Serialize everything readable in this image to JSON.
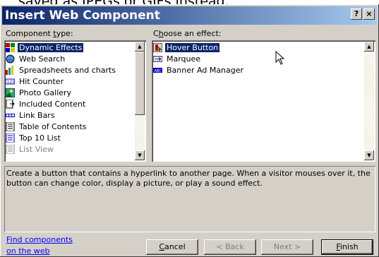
{
  "background_text": "saved as JPEGs or GIFs instead.",
  "window": {
    "title": "Insert Web Component",
    "help_button": "?",
    "close_button": "×"
  },
  "component_type": {
    "label_prefix": "Component ",
    "label_hot": "t",
    "label_suffix": "ype:",
    "items": [
      {
        "label": "Dynamic Effects",
        "icon": "effects-icon",
        "selected": true
      },
      {
        "label": "Web Search",
        "icon": "web-search-icon"
      },
      {
        "label": "Spreadsheets and charts",
        "icon": "spreadsheet-icon"
      },
      {
        "label": "Hit Counter",
        "icon": "hit-counter-icon"
      },
      {
        "label": "Photo Gallery",
        "icon": "photo-gallery-icon"
      },
      {
        "label": "Included Content",
        "icon": "included-content-icon"
      },
      {
        "label": "Link Bars",
        "icon": "link-bars-icon"
      },
      {
        "label": "Table of Contents",
        "icon": "table-of-contents-icon"
      },
      {
        "label": "Top 10 List",
        "icon": "top10-list-icon"
      },
      {
        "label": "List View",
        "icon": "list-view-icon",
        "disabled": true
      }
    ]
  },
  "effect": {
    "label_prefix": "C",
    "label_hot": "h",
    "label_suffix": "oose an effect:",
    "items": [
      {
        "label": "Hover Button",
        "icon": "hover-button-icon",
        "selected": true
      },
      {
        "label": "Marquee",
        "icon": "marquee-icon"
      },
      {
        "label": "Banner Ad Manager",
        "icon": "banner-ad-icon"
      }
    ]
  },
  "description": "Create a button that contains a hyperlink to another page.  When a visitor mouses over it, the button can change color, display a picture, or play a sound effect.",
  "find_link": {
    "line1": "Find components",
    "line2": "on the web"
  },
  "buttons": {
    "cancel": "Cancel",
    "cancel_hot": "C",
    "cancel_rest": "ancel",
    "back": "< Back",
    "next": "Next >",
    "finish_hot": "F",
    "finish_rest": "inish"
  },
  "colors": {
    "titlebar_start": "#0a246a",
    "titlebar_end": "#a6caf0",
    "selection": "#0a246a",
    "face": "#d4d0c8"
  }
}
